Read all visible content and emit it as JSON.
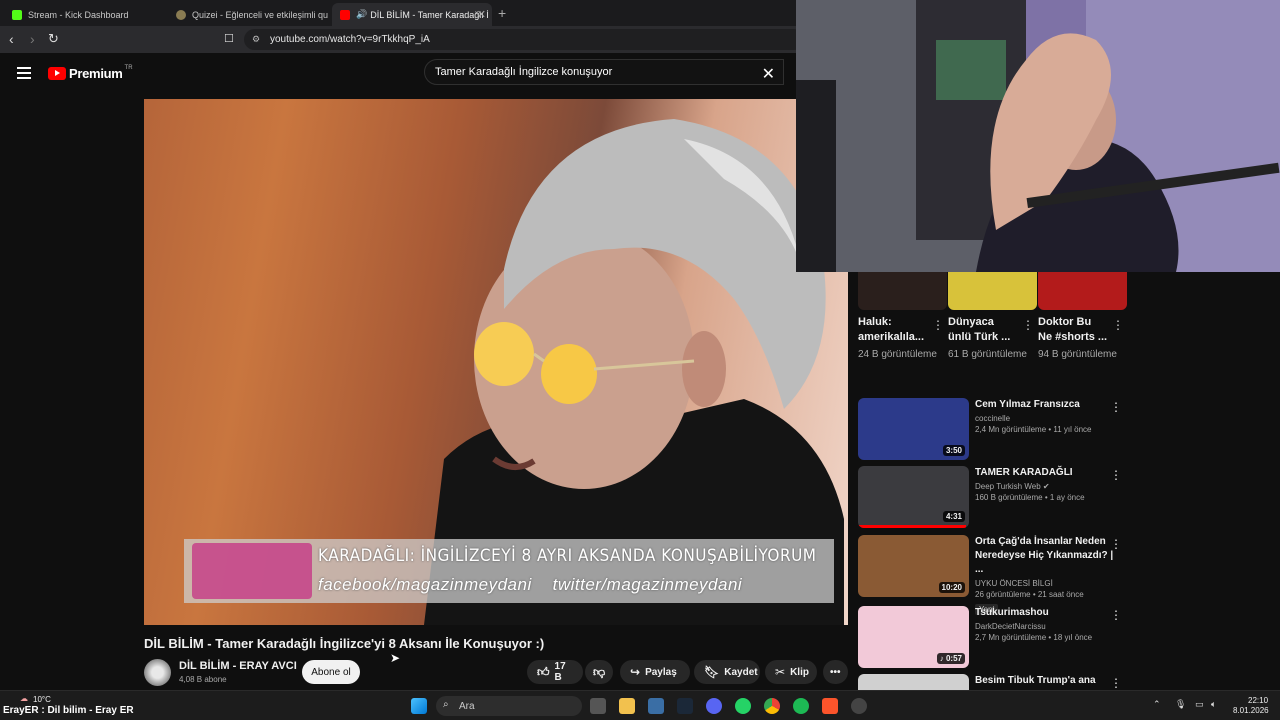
{
  "browser": {
    "tabs": [
      {
        "label": "Stream - Kick Dashboard",
        "favicon_color": "#53fc18"
      },
      {
        "label": "Quizei - Eğlenceli ve etkileşimli quizle",
        "favicon_color": "#8a7c52"
      },
      {
        "label": "DİL BİLİM - Tamer Karadağlı İ",
        "favicon_color": "#ff0000"
      }
    ],
    "new_tab": "+",
    "url": "youtube.com/watch?v=9rTkkhqP_iA"
  },
  "header": {
    "logo_word": "Premium",
    "logo_region": "TR",
    "search_query": "Tamer Karadağlı İngilizce konuşuyor"
  },
  "video": {
    "overlay_line1": "KARADAĞLI: İNGİLİZCEYİ 8 AYRI AKSANDA KONUŞABİLİYORUM",
    "overlay_line2": "facebook/magazinmeydani    twitter/magazinmeydani",
    "title": "DİL BİLİM - Tamer Karadağlı İngilizce'yi 8 Aksanı İle Konuşuyor :)",
    "channel_name": "DİL BİLİM - ERAY AVCI",
    "channel_subs": "4,08 B abone",
    "subscribe_label": "Abone ol",
    "likes": "17 B",
    "share_label": "Paylaş",
    "save_label": "Kaydet",
    "clip_label": "Klip"
  },
  "shorts": [
    {
      "title": "Haluk: amerikalıla...",
      "views": "24 B görüntüleme",
      "thumb_color": "#2a1f1c"
    },
    {
      "title": "Dünyaca ünlü Türk ...",
      "views": "61 B görüntüleme",
      "thumb_color": "#d8c23a"
    },
    {
      "title": "Doktor Bu Ne #shorts ...",
      "views": "94 B görüntüleme",
      "thumb_color": "#b31b1b"
    }
  ],
  "recommendations": [
    {
      "title": "Cem Yılmaz Fransızca",
      "channel": "coccinelle",
      "meta": "2,4 Mn görüntüleme • 11 yıl önce",
      "duration": "3:50",
      "thumb_color": "#2c3a8a",
      "verified": false,
      "badge": ""
    },
    {
      "title": "TAMER KARADAĞLI",
      "channel": "Deep Turkish Web",
      "meta": "160 B görüntüleme • 1 ay önce",
      "duration": "4:31",
      "thumb_color": "#3b3b3f",
      "verified": true,
      "badge": "",
      "progress": 0.97
    },
    {
      "title": "Orta Çağ'da İnsanlar Neden Neredeyse Hiç Yıkanmazdı? | ...",
      "channel": "UYKU ÖNCESİ BİLGİ",
      "meta": "26 görüntüleme • 21 saat önce",
      "duration": "10:20",
      "thumb_color": "#8a5a34",
      "verified": false,
      "badge": "Yeni"
    },
    {
      "title": "Tsukurimashou",
      "channel": "DarkDecietNarcissu",
      "meta": "2,7 Mn görüntüleme • 18 yıl önce",
      "duration": "0:57",
      "thumb_color": "#f2c9d8",
      "verified": false,
      "badge": ""
    },
    {
      "title": "Besim Tibuk Trump'a ana avrat",
      "channel": "",
      "meta": "",
      "duration": "",
      "thumb_color": "#d0d0d0",
      "verified": false,
      "badge": ""
    }
  ],
  "taskbar": {
    "weather": "10°C",
    "stream_title": "ErayER : Dil bilim - Eray ER",
    "search_label": "Ara",
    "time": "22:10",
    "date": "8.01.2026"
  }
}
